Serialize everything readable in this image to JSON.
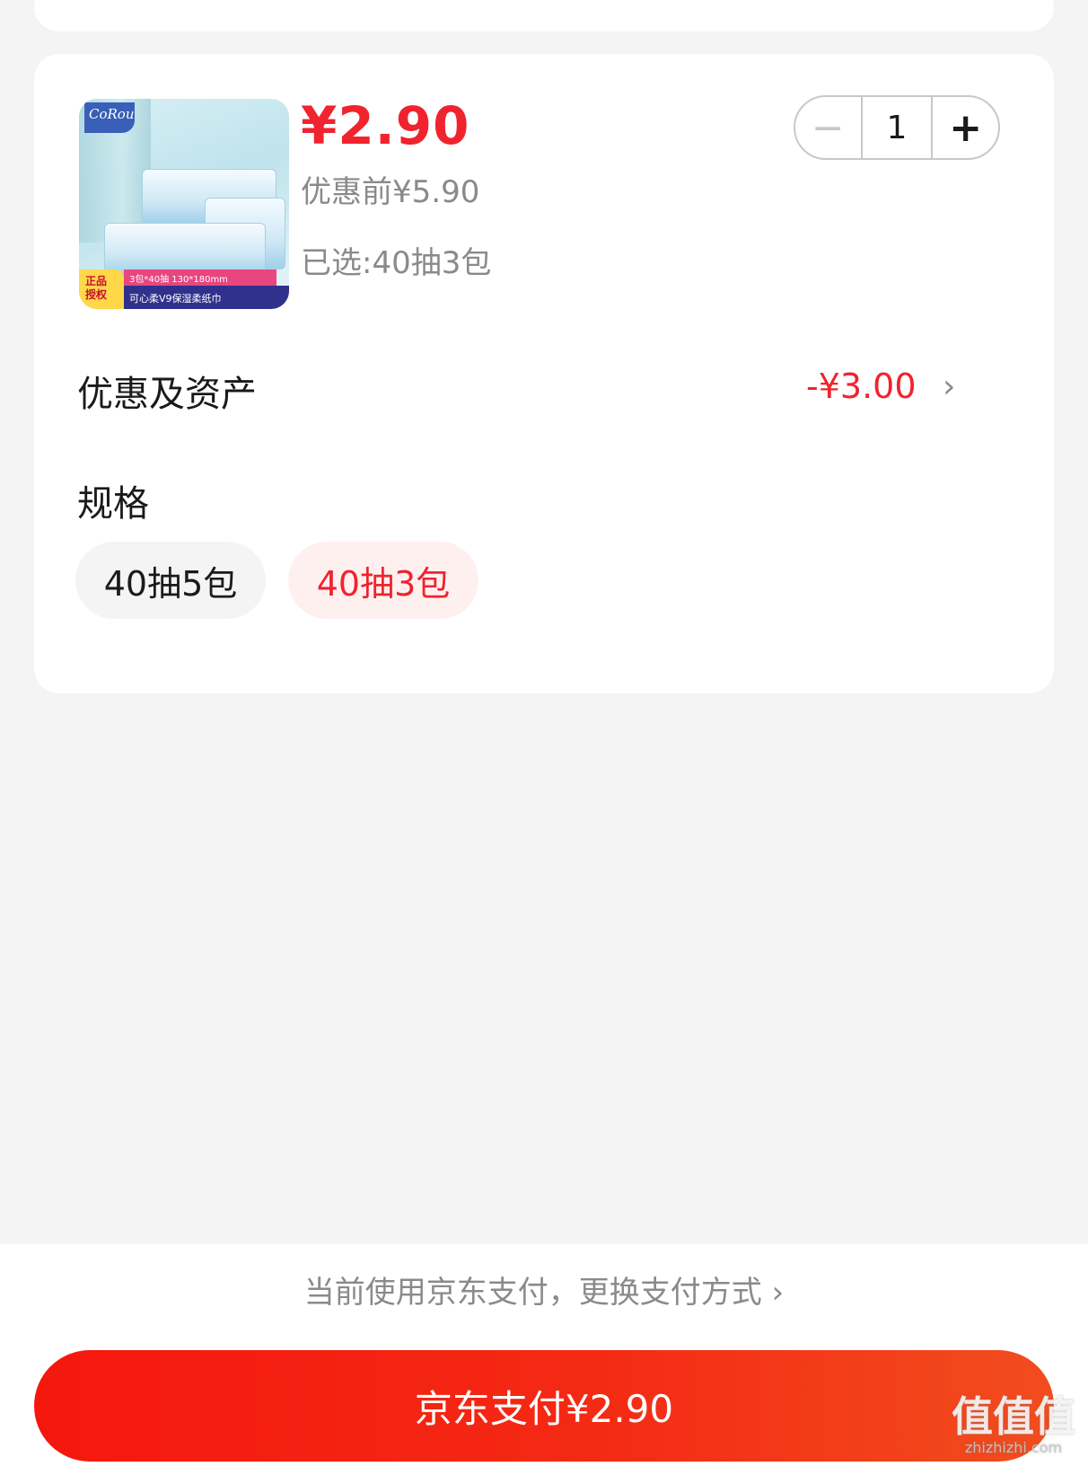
{
  "product": {
    "price": "¥2.90",
    "original_price": "优惠前¥5.90",
    "selected_spec": "已选:40抽3包",
    "thumbnail": {
      "logo_text": "CoRou",
      "tag_text": "3包*40抽  130*180mm",
      "name_text": "可心柔V9保湿柔纸巾",
      "badge_line1": "正品",
      "badge_line2": "授权"
    }
  },
  "quantity": {
    "minus_icon": "minus-icon",
    "plus_icon": "plus-icon",
    "minus_label": "−",
    "plus_label": "+",
    "value": "1"
  },
  "discount": {
    "label": "优惠及资产",
    "value": "-¥3.00",
    "chevron": "›"
  },
  "spec": {
    "label": "规格",
    "options": [
      {
        "label": "40抽5包",
        "selected": false
      },
      {
        "label": "40抽3包",
        "selected": true
      }
    ]
  },
  "payment": {
    "method_text": "当前使用京东支付，更换支付方式 ›",
    "button_label": "京东支付¥2.90"
  },
  "watermark": {
    "title": "值值值",
    "sub": "zhizhizhi.com"
  },
  "colors": {
    "accent": "#f0232e",
    "background": "#f4f4f4",
    "selected_bg": "#fff0f0"
  }
}
